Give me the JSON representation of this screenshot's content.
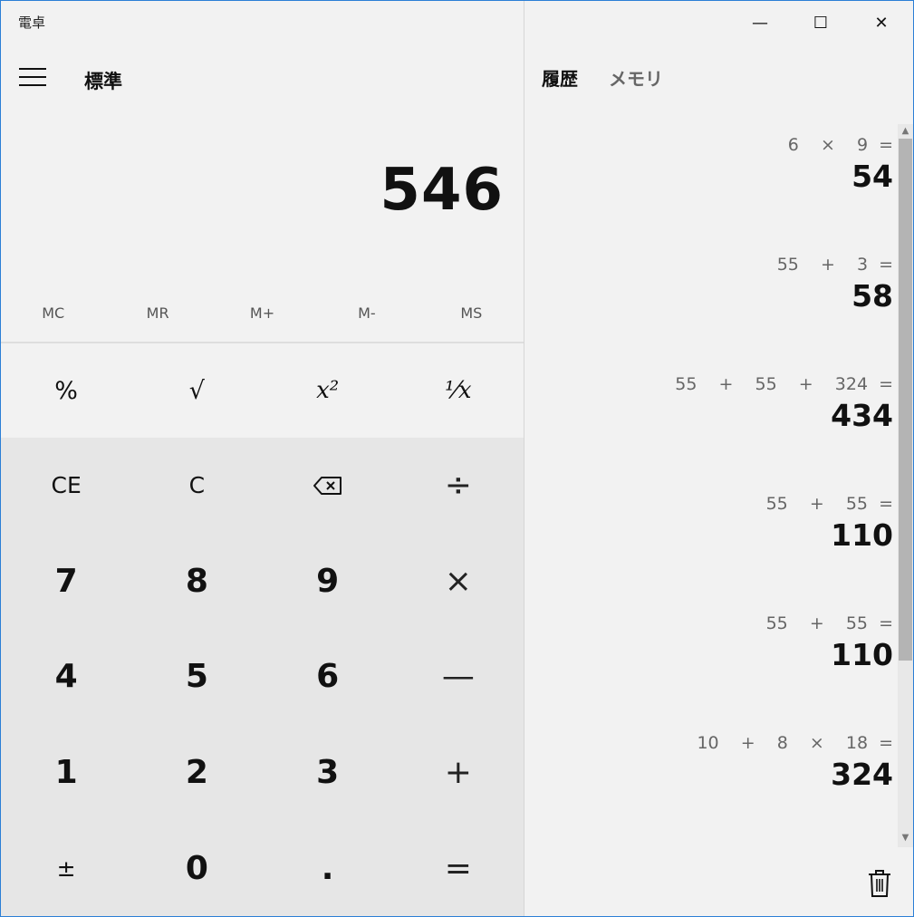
{
  "window": {
    "title": "電卓",
    "minimize": "—",
    "maximize": "☐",
    "close": "✕"
  },
  "header": {
    "mode": "標準"
  },
  "display": {
    "value": "546"
  },
  "memory": [
    "MC",
    "MR",
    "M+",
    "M-",
    "MS"
  ],
  "functions": {
    "percent": "%",
    "sqrt": "√",
    "square": "x²",
    "reciprocal": "⅟x"
  },
  "keys": {
    "ce": "CE",
    "c": "C",
    "divide": "÷",
    "seven": "7",
    "eight": "8",
    "nine": "9",
    "multiply": "×",
    "four": "4",
    "five": "5",
    "six": "6",
    "minus": "—",
    "one": "1",
    "two": "2",
    "three": "3",
    "plus": "+",
    "negate": "±",
    "zero": "0",
    "decimal": ".",
    "equals": "="
  },
  "side_tabs": {
    "history": "履歴",
    "memory": "メモリ"
  },
  "history": [
    {
      "expr": "6  ×  9 =",
      "result": "54"
    },
    {
      "expr": "55  +  3 =",
      "result": "58"
    },
    {
      "expr": "55  +  55  +  324 =",
      "result": "434"
    },
    {
      "expr": "55  +  55 =",
      "result": "110"
    },
    {
      "expr": "55  +  55 =",
      "result": "110"
    },
    {
      "expr": "10  +  8  ×  18 =",
      "result": "324"
    }
  ],
  "icons": {
    "menu": "hamburger-icon",
    "backspace": "backspace-icon",
    "trash": "trash-icon"
  }
}
